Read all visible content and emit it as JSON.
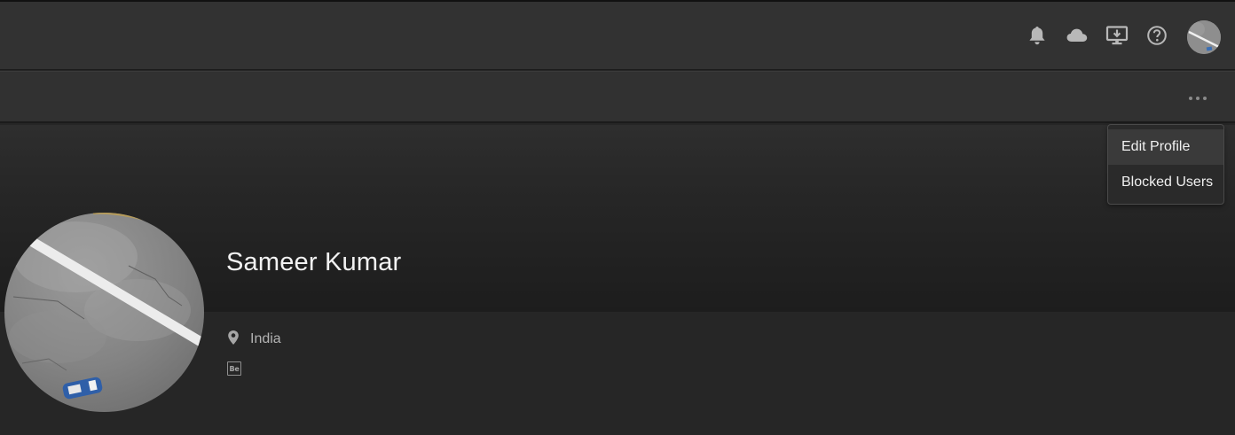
{
  "header": {
    "icons": [
      "bell-icon",
      "cloud-icon",
      "desktop-download-icon",
      "help-icon"
    ],
    "avatar": "user-avatar"
  },
  "toolbar": {
    "more_icon": "more-options-icon"
  },
  "menu": {
    "items": [
      {
        "label": "Edit Profile",
        "active": true
      },
      {
        "label": "Blocked Users",
        "active": false
      }
    ]
  },
  "profile": {
    "name": "Sameer Kumar",
    "location": "India",
    "behance_label": "Be"
  },
  "colors": {
    "background": "#262626",
    "topbar": "#323232",
    "menu_background": "#2a2a2a",
    "menu_border": "#4a4a4a",
    "text_primary": "#f2f2f2",
    "text_secondary": "#b3b3b3"
  }
}
